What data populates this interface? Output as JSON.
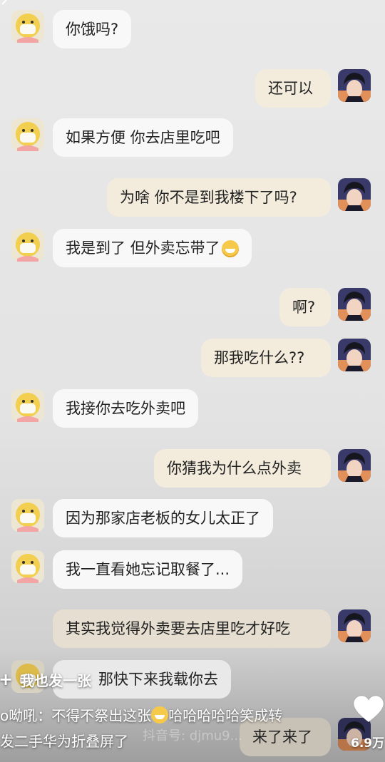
{
  "messages": [
    {
      "side": "left",
      "text": "你饿吗?"
    },
    {
      "side": "right",
      "text": "还可以"
    },
    {
      "side": "left",
      "text": "如果方便 你去店里吃吧"
    },
    {
      "side": "right",
      "text": "为啥 你不是到我楼下了吗?"
    },
    {
      "side": "left",
      "text": "我是到了 但外卖忘带了",
      "emoji": "grinning-sweat-emoji"
    },
    {
      "side": "right",
      "text": "啊?"
    },
    {
      "side": "right",
      "text": "那我吃什么??"
    },
    {
      "side": "left",
      "text": "我接你去吃外卖吧"
    },
    {
      "side": "right",
      "text": "你猜我为什么点外卖"
    },
    {
      "side": "left",
      "text": "因为那家店老板的女儿太正了"
    },
    {
      "side": "left",
      "text": "我一直看她忘记取餐了..."
    },
    {
      "side": "right",
      "text": "其实我觉得外卖要去店里吃才好吃"
    },
    {
      "side": "left",
      "text": "那快下来我载你去"
    },
    {
      "side": "right",
      "text": "来了来了"
    }
  ],
  "overlay": {
    "post_button_icon": "plus-icon",
    "post_button_label": "我也发一张",
    "caption_line1_prefix": "o呦吼：不得不祭出这张",
    "caption_line1_suffix": "哈哈哈哈哈笑成转",
    "caption_line2": "发二手华为折叠屏了",
    "watermark": "抖音号: djmu9...",
    "like_icon": "heart-icon",
    "like_count": "6.9万"
  },
  "colors": {
    "left_bubble": "#f8f8f8",
    "right_bubble": "#f3ecdd",
    "emoji": "#f6c94a"
  }
}
